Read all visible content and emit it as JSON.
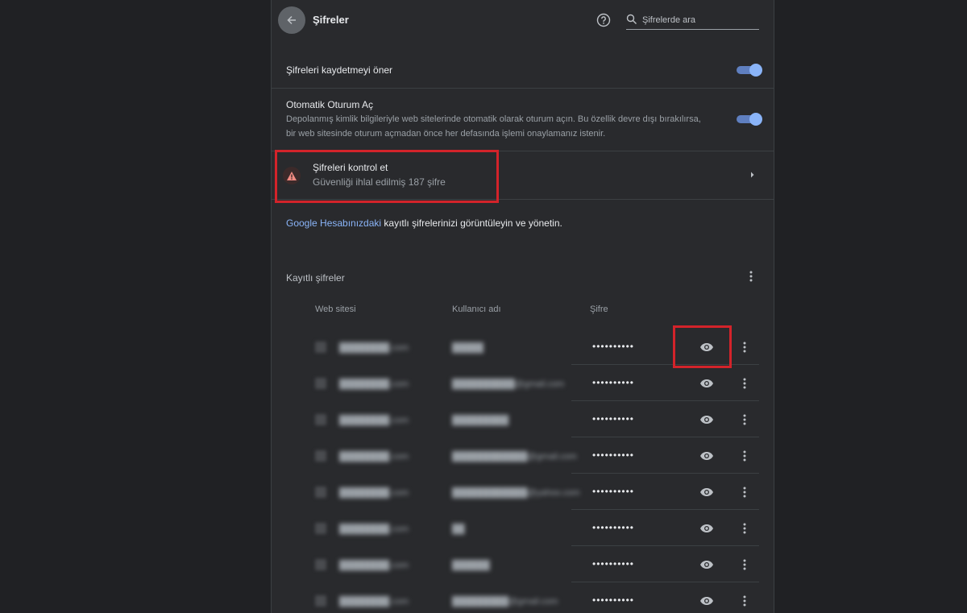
{
  "header": {
    "title": "Şifreler",
    "search_placeholder": "Şifrelerde ara"
  },
  "offer_save": {
    "label": "Şifreleri kaydetmeyi öner",
    "enabled": true
  },
  "auto_signin": {
    "title": "Otomatik Oturum Aç",
    "description": "Depolanmış kimlik bilgileriyle web sitelerinde otomatik olarak oturum açın. Bu özellik devre dışı bırakılırsa, bir web sitesinde oturum açmadan önce her defasında işlemi onaylamanız istenir.",
    "enabled": true
  },
  "check_passwords": {
    "title": "Şifreleri kontrol et",
    "subtitle": "Güvenliği ihlal edilmiş 187 şifre"
  },
  "google_account": {
    "link_text": "Google Hesabınızdaki",
    "rest_text": " kayıtlı şifrelerinizi görüntüleyin ve yönetin."
  },
  "saved_passwords": {
    "heading": "Kayıtlı şifreler",
    "columns": [
      "Web sitesi",
      "Kullanıcı adı",
      "Şifre"
    ],
    "rows": [
      {
        "site": "████████.com",
        "user": "█████",
        "password": "••••••••••"
      },
      {
        "site": "████████.com",
        "user": "██████████@gmail.com",
        "password": "••••••••••"
      },
      {
        "site": "████████.com",
        "user": "█████████",
        "password": "••••••••••"
      },
      {
        "site": "████████.com",
        "user": "████████████@gmail.com",
        "password": "••••••••••"
      },
      {
        "site": "████████.com",
        "user": "████████████@yahoo.com",
        "password": "••••••••••"
      },
      {
        "site": "████████.com",
        "user": "██",
        "password": "••••••••••"
      },
      {
        "site": "████████.com",
        "user": "██████",
        "password": "••••••••••"
      },
      {
        "site": "████████.com",
        "user": "█████████@gmail.com",
        "password": "••••••••••"
      }
    ]
  },
  "colors": {
    "accent": "#8ab4f8",
    "highlight": "#d3232a",
    "warning": "#f28b82"
  }
}
